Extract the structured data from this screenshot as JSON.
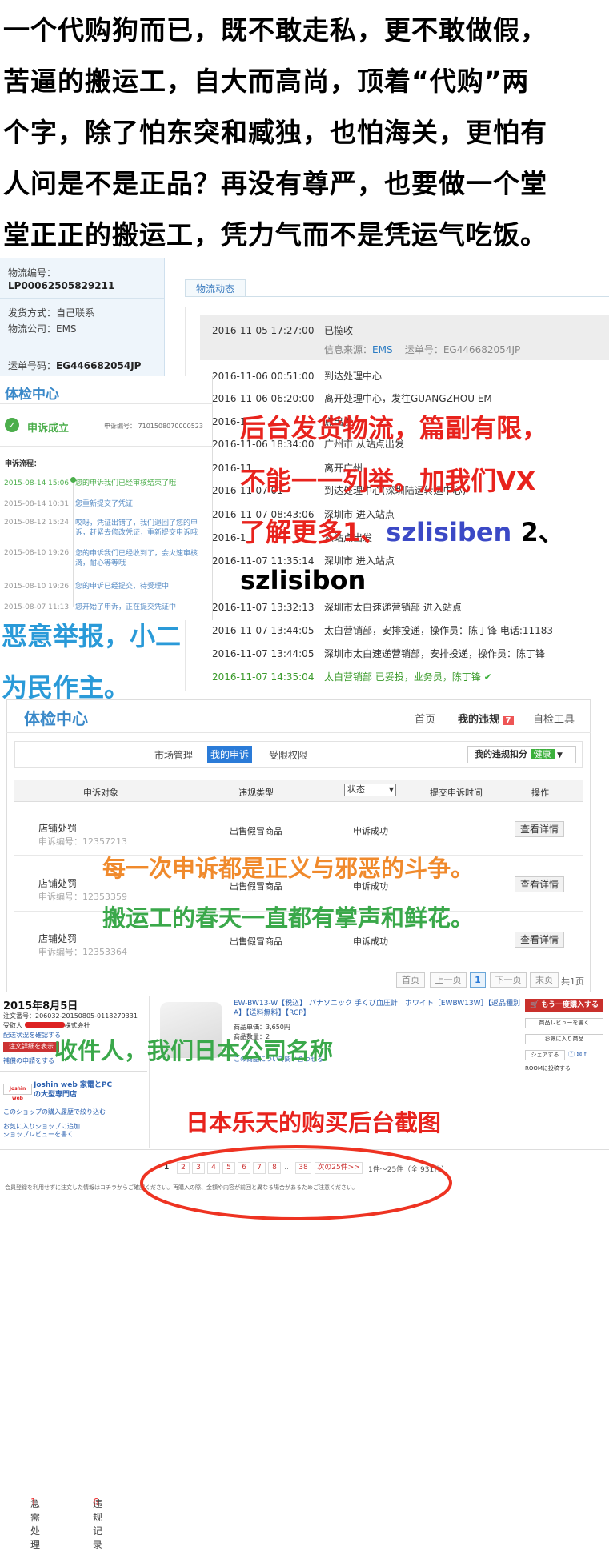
{
  "intro": {
    "lines": [
      "一个代购狗而已，既不敢走私，更不敢做假，",
      "苦逼的搬运工，自大而高尚，顶着“代购”两",
      "个字，除了怕东突和臧独，也怕海关，更怕有",
      "人问是不是正品？再没有尊严，也要做一个堂",
      "堂正正的搬运工，凭力气而不是凭运气吃饭。"
    ]
  },
  "logistics": {
    "no_label": "物流编号：",
    "no_value": "LP00062505829211",
    "ship_label": "发货方式：自己联系",
    "company_label": "物流公司：EMS",
    "waybill_label": "运单号码：",
    "waybill_value": "EG446682054JP",
    "tab": "物流动态",
    "source_label": "信息来源：",
    "source_value": "EMS",
    "waybill_inline": "运单号：EG446682054JP",
    "events": [
      {
        "time": "2016-11-05 17:27:00",
        "desc": "已揽收"
      },
      {
        "time": "2016-11-06 00:51:00",
        "desc": "到达处理中心"
      },
      {
        "time": "2016-11-06 06:20:00",
        "desc": "离开处理中心，发往GUANGZHOU EM"
      },
      {
        "time": "2016-11-06 18:34:00",
        "desc": "广州市 从站点出发"
      },
      {
        "time": "2016-11-07 08:43:06",
        "desc": "深圳市 进入站点"
      },
      {
        "time": "2016-11-07 11:35:14",
        "desc": "深圳市 进入站点"
      },
      {
        "time": "2016-11-07 13:32:13",
        "desc": "深圳市太白速递营销部 进入站点"
      },
      {
        "time": "2016-11-07 13:44:05",
        "desc": "太白营销部，安排投递，操作员：陈丁锋 电话:11183"
      },
      {
        "time": "2016-11-07 13:44:05",
        "desc": "深圳市太白速递营销部，安排投递，操作员：陈丁锋"
      },
      {
        "time": "2016-11-07 14:35:04",
        "desc": "太白营销部 已妥投，业务员，陈丁锋"
      }
    ],
    "partial_rows": [
      {
        "time": "2016-11",
        "desc": "离开广州"
      },
      {
        "time": "2016-11-07 01",
        "desc": "到达处理中心(深圳陆运转运中心)"
      },
      {
        "time": "2016-1",
        "desc": "点出发"
      },
      {
        "time": "2016-1",
        "desc": "从站点出发"
      }
    ]
  },
  "appeal_card": {
    "title": "体检中心",
    "status": "申诉成立",
    "appeal_no": "申诉编号： 7101508070000523",
    "flow_label": "申诉流程：",
    "timeline": [
      {
        "date": "2015-08-14 15:06",
        "msg": "您的申诉我们已经审核结束了哦"
      },
      {
        "date": "2015-08-14 10:31",
        "msg": "您重新提交了凭证"
      },
      {
        "date": "2015-08-12 15:24",
        "msg": "哎呀，凭证出错了，我们退回了您的申诉，赶紧去修改凭证，重新提交申诉哦"
      },
      {
        "date": "2015-08-10 19:26",
        "msg": "您的申诉我们已经收到了，会火速审核滴，耐心等等哦"
      },
      {
        "date": "2015-08-10 19:26",
        "msg": "您的申诉已经提交，待受理中"
      },
      {
        "date": "2015-08-07 11:13",
        "msg": "您开始了申诉，正在提交凭证中"
      }
    ]
  },
  "overlays": {
    "red1": "后台发货物流，篇副有限，",
    "red2": "不能一一列举。加我们VX",
    "red3a": "了解更多1、",
    "vx1": "szlisiben",
    "red3b": " 2、",
    "vx2": "szlisibon",
    "blue1": "恶意举报，小二",
    "blue2": "为民作主。",
    "orange": "每一次申诉都是正义与邪恶的斗争。",
    "green": "搬运工的春天一直都有掌声和鲜花。",
    "green2": "收件人，我们日本公司名称",
    "red_bottom": "日本乐天的购买后台截图"
  },
  "panel2": {
    "title": "体检中心",
    "nav_home": "首页",
    "nav_violations": "我的违规",
    "nav_violations_count": "7",
    "nav_tools": "自检工具",
    "tabs": [
      "急需处理",
      "违规记录",
      "市场管理",
      "我的申诉",
      "受限权限"
    ],
    "tab_counts": [
      "1",
      "6"
    ],
    "score_label": "我的违规扣分",
    "score_badge": "健康",
    "col_obj": "申诉对象",
    "col_type": "违规类型",
    "col_status": "状态",
    "col_time": "提交申诉时间",
    "col_op": "操作",
    "rows": [
      {
        "obj": "店铺处罚",
        "no": "申诉编号：12357213",
        "type": "出售假冒商品",
        "status": "申诉成功",
        "btn": "查看详情"
      },
      {
        "obj": "店铺处罚",
        "no": "申诉编号：12353359",
        "type": "出售假冒商品",
        "status": "申诉成功",
        "btn": "查看详情"
      },
      {
        "obj": "店铺处罚",
        "no": "申诉编号：12353364",
        "type": "出售假冒商品",
        "status": "申诉成功",
        "btn": "查看详情"
      }
    ],
    "pager": [
      "首页",
      "上一页",
      "1",
      "下一页",
      "末页"
    ],
    "pager_total": "共1页"
  },
  "rakuten": {
    "date": "2015年8月5日",
    "order_no": "注文番号：206032-20150805-0118279331",
    "receiver": "受取人",
    "receiver_suffix": "株式会社",
    "delivery": "配送状況を確認する",
    "detail_btn": "注文詳細を表示",
    "apply": "補償の申請をする",
    "shop_logo": "Joshin web",
    "shop_name1": "Joshin web 家電とPC",
    "shop_name2": "の大型専門店",
    "shop_hist": "このショップの購入履歴で絞り込む",
    "shop_fav": "お気に入りショップに追加",
    "shop_review": "ショップレビューを書く",
    "product": "EW-BW13-W【税込】 パナソニック 手くび血圧計　ホワイト［EWBW13W］【返品種別A】【送料無料】【RCP】",
    "price": "商品単価：3,650円",
    "qty": "商品数量：2",
    "review_product": "この商品について問い合わせる",
    "buy_again": "もう一度購入する",
    "btn_review": "商品レビューを書く",
    "btn_fav": "お気に入り商品",
    "btn_share": "シェアする",
    "btn_room": "ROOMに投稿する",
    "pages": [
      "1",
      "2",
      "3",
      "4",
      "5",
      "6",
      "7",
      "8",
      "…",
      "38"
    ],
    "next": "次の25件>>",
    "count": "1件～25件（全 931件）",
    "footer": "会員登録を利用せずに注文した情報はコチラからご確認ください。再購入の際、金額や内容が前回と異なる場合があるためご注意ください。"
  }
}
